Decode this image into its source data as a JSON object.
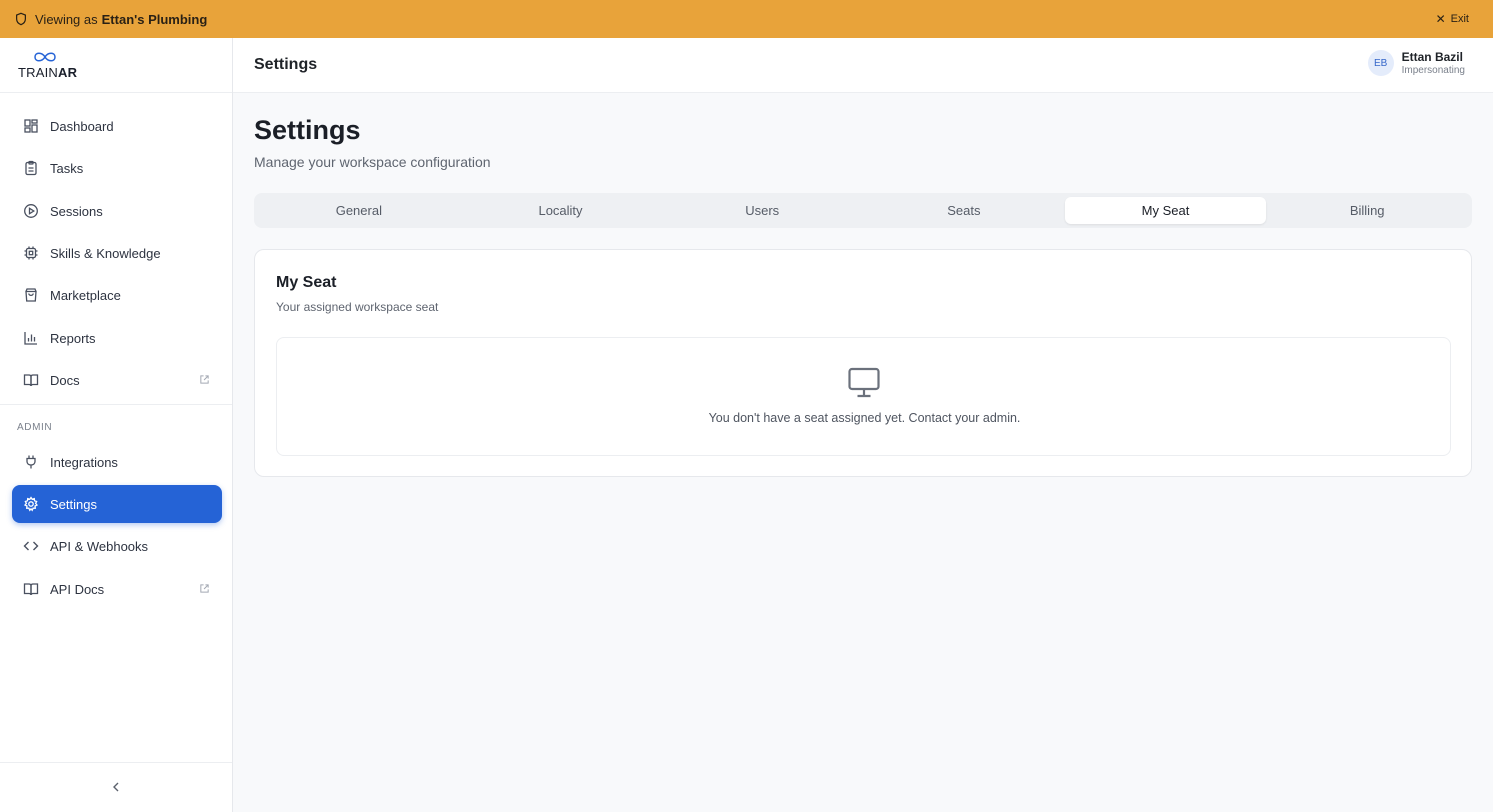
{
  "banner": {
    "prefix": "Viewing as",
    "org": "Ettan's Plumbing",
    "exit_label": "Exit",
    "color": "#e8a33a"
  },
  "logo": {
    "word_a": "TRAIN",
    "word_b": "AR"
  },
  "sidebar": {
    "items": [
      {
        "label": "Dashboard",
        "icon": "dashboard-icon"
      },
      {
        "label": "Tasks",
        "icon": "clipboard-icon"
      },
      {
        "label": "Sessions",
        "icon": "play-circle-icon"
      },
      {
        "label": "Skills & Knowledge",
        "icon": "chip-icon"
      },
      {
        "label": "Marketplace",
        "icon": "shopping-bag-icon"
      },
      {
        "label": "Reports",
        "icon": "bar-chart-icon"
      },
      {
        "label": "Docs",
        "icon": "book-icon",
        "external": true
      }
    ],
    "admin_label": "ADMIN",
    "admin_items": [
      {
        "label": "Integrations",
        "icon": "plug-icon"
      },
      {
        "label": "Settings",
        "icon": "gear-icon",
        "active": true
      },
      {
        "label": "API & Webhooks",
        "icon": "code-icon"
      },
      {
        "label": "API Docs",
        "icon": "book-icon",
        "external": true
      }
    ],
    "active_color": "#2563d6"
  },
  "topbar": {
    "title": "Settings"
  },
  "user": {
    "initials": "EB",
    "name": "Ettan Bazil",
    "status": "Impersonating"
  },
  "main": {
    "title": "Settings",
    "subtitle": "Manage your workspace configuration",
    "tabs": [
      {
        "label": "General"
      },
      {
        "label": "Locality"
      },
      {
        "label": "Users"
      },
      {
        "label": "Seats"
      },
      {
        "label": "My Seat",
        "active": true
      },
      {
        "label": "Billing"
      }
    ],
    "card": {
      "title": "My Seat",
      "subtitle": "Your assigned workspace seat",
      "empty_icon": "monitor-icon",
      "empty_message": "You don't have a seat assigned yet. Contact your admin."
    }
  }
}
